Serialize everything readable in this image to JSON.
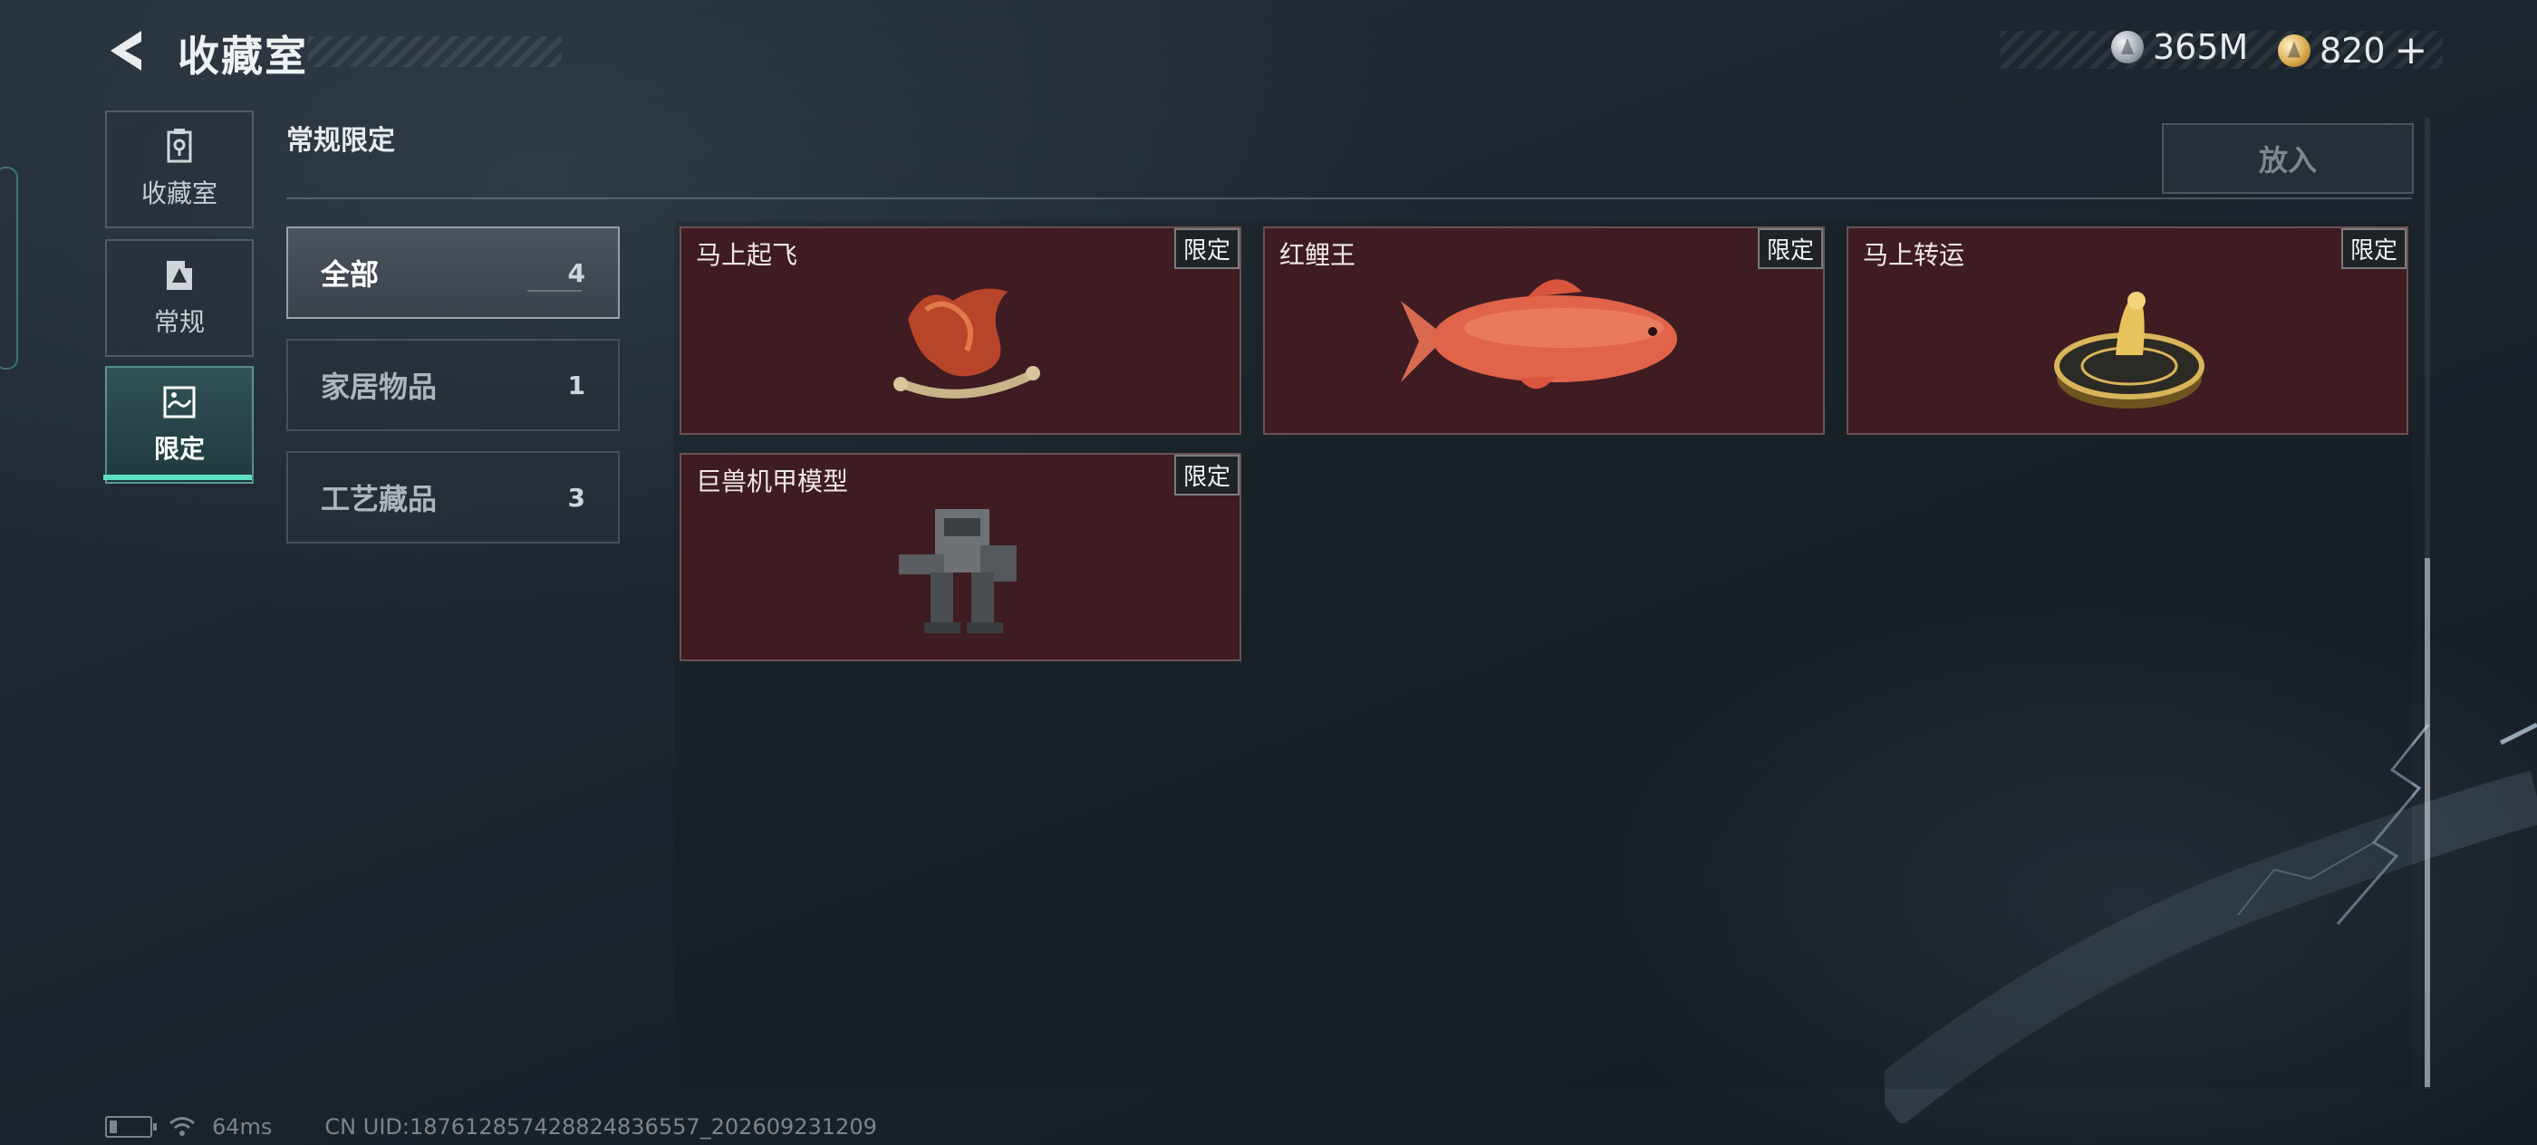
{
  "header": {
    "title": "收藏室",
    "currencies": [
      {
        "icon": "silver-coin-icon",
        "amount": "365M"
      },
      {
        "icon": "gold-coin-icon",
        "amount": "820"
      }
    ],
    "add_symbol": "+"
  },
  "sidebar": {
    "items": [
      {
        "label": "收藏室",
        "icon": "collection-room-icon",
        "active": false
      },
      {
        "label": "常规",
        "icon": "regular-icon",
        "active": false
      },
      {
        "label": "限定",
        "icon": "limited-icon",
        "active": true
      }
    ]
  },
  "main": {
    "section_title": "常规限定",
    "put_button": "放入",
    "filters": [
      {
        "label": "全部",
        "count": "4",
        "active": true
      },
      {
        "label": "家居物品",
        "count": "1",
        "active": false
      },
      {
        "label": "工艺藏品",
        "count": "3",
        "active": false
      }
    ],
    "items": [
      {
        "name": "马上起飞",
        "tag": "限定",
        "image": "red-jade-horse-statue"
      },
      {
        "name": "红鲤王",
        "tag": "限定",
        "image": "red-carp"
      },
      {
        "name": "马上转运",
        "tag": "限定",
        "image": "golden-horse-disc"
      },
      {
        "name": "巨兽机甲模型",
        "tag": "限定",
        "image": "mech-model"
      }
    ]
  },
  "status_bar": {
    "ping": "64ms",
    "uid": "CN UID:18761285742882483655​7_202609231209"
  },
  "colors": {
    "accent": "#5ee0c0",
    "card_bg": "#3e1c21",
    "background": "#1c242d"
  }
}
